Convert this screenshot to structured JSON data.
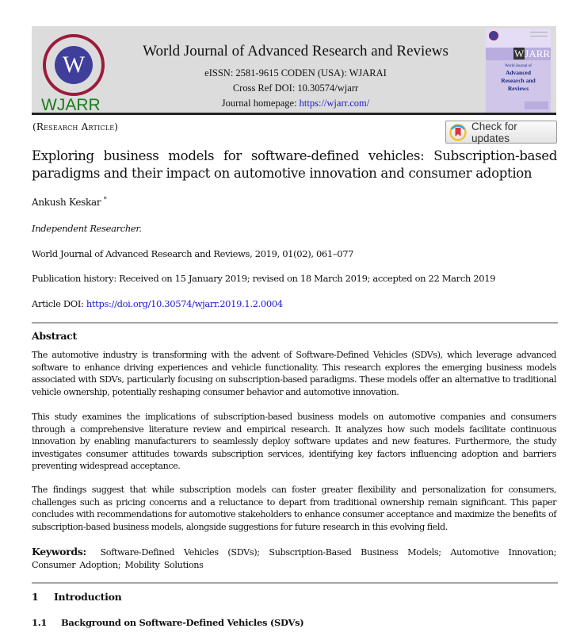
{
  "header": {
    "logo_letter": "W",
    "logo_text": "WJARR",
    "journal_title": "World Journal of Advanced Research and Reviews",
    "eissn_line": "eISSN: 2581-9615  CODEN (USA): WJARAI",
    "crossref_line": "Cross Ref DOI: 10.30574/wjarr",
    "homepage_label": "Journal homepage: ",
    "homepage_url": "https://wjarr.com/",
    "cover": {
      "brand": "WJARR",
      "subtitle_small": "World Journal of",
      "subtitle_lines": [
        "Advanced",
        "Research and",
        "Reviews"
      ]
    }
  },
  "article_type": "(Research Article)",
  "check_updates_label": "Check for updates",
  "title": "Exploring business models for software-defined vehicles: Subscription-based paradigms and their impact on automotive innovation and consumer adoption",
  "author": {
    "name": "Ankush Keskar",
    "mark": "*"
  },
  "affiliation": "Independent Researcher.",
  "citation": "World Journal of Advanced Research and Reviews, 2019, 01(02), 061–077",
  "publication_history": "Publication history: Received on 15 January 2019; revised on 18 March 2019; accepted on 22 March 2019",
  "doi": {
    "label": "Article DOI: ",
    "url": "https://doi.org/10.30574/wjarr.2019.1.2.0004"
  },
  "abstract": {
    "heading": "Abstract",
    "paragraphs": [
      "The automotive industry is transforming with the advent of Software-Defined Vehicles (SDVs), which leverage advanced software to enhance driving experiences and vehicle functionality. This research explores the emerging business models associated with SDVs, particularly focusing on subscription-based paradigms. These models offer an alternative to traditional vehicle ownership, potentially reshaping consumer behavior and automotive innovation.",
      "This study examines the implications of subscription-based business models on automotive companies and consumers through a comprehensive literature review and empirical research. It analyzes how such models facilitate continuous innovation by enabling manufacturers to seamlessly deploy software updates and new features. Furthermore, the study investigates consumer attitudes towards subscription services, identifying key factors influencing adoption and barriers preventing widespread acceptance.",
      "The findings suggest that while subscription models can foster greater flexibility and personalization for consumers, challenges such as pricing concerns and a reluctance to depart from traditional ownership remain significant. This paper concludes with recommendations for automotive stakeholders to enhance consumer acceptance and maximize the benefits of subscription-based business models, alongside suggestions for future research in this evolving field."
    ]
  },
  "keywords": {
    "label": "Keywords:",
    "text": "Software-Defined Vehicles (SDVs); Subscription-Based Business Models; Automotive Innovation; Consumer Adoption; Mobility Solutions"
  },
  "sections": [
    {
      "number": "1",
      "title": "Introduction"
    },
    {
      "number": "1.1",
      "title": "Background on Software-Defined Vehicles (SDVs)"
    }
  ],
  "colors": {
    "link": "#1a1ad0",
    "logo_ring": "#9c1b3c",
    "logo_fill": "#3f3f9b",
    "logo_text": "#1c7a1c",
    "header_bg": "#dcdcdc"
  }
}
